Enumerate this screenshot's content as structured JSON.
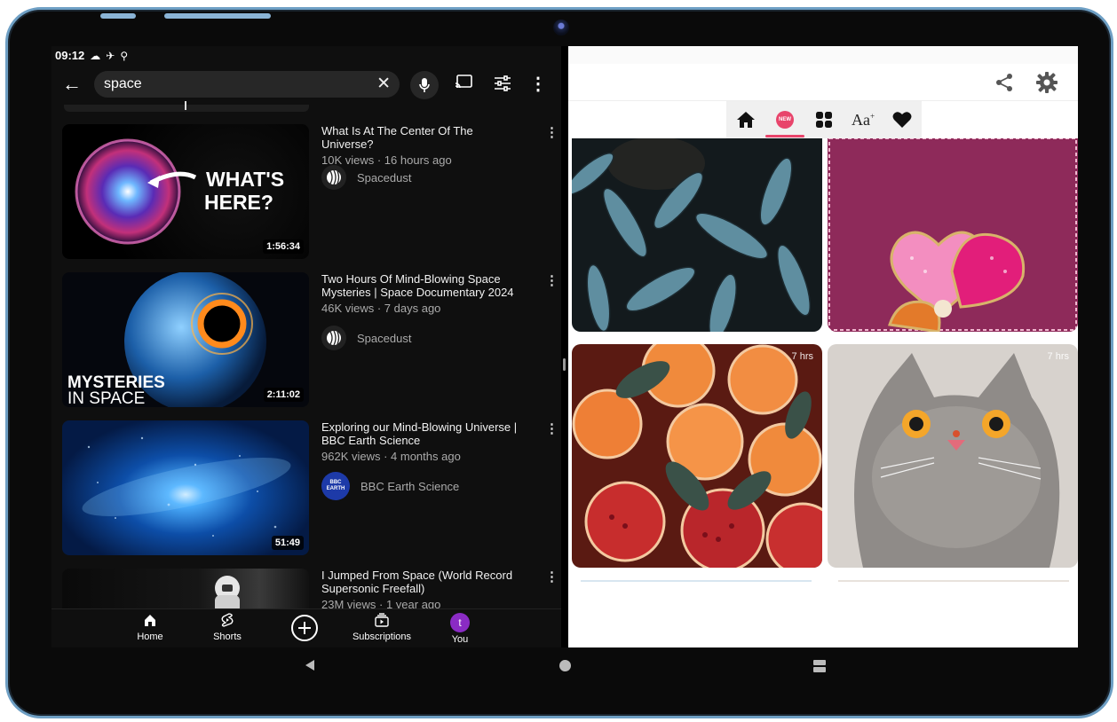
{
  "status": {
    "time": "09:12"
  },
  "search": {
    "query": "space"
  },
  "videos": [
    {
      "title": "What Is At The Center Of The Universe?",
      "meta": "10K views · 16 hours ago",
      "channel": "Spacedust",
      "duration": "1:56:34",
      "overlay": [
        "WHAT'S",
        "HERE?"
      ]
    },
    {
      "title": "Two Hours Of Mind-Blowing Space Mysteries | Space Documentary 2024",
      "meta": "46K views · 7 days ago",
      "channel": "Spacedust",
      "duration": "2:11:02",
      "overlay": [
        "MYSTERIES",
        "IN SPACE"
      ]
    },
    {
      "title": "Exploring our Mind-Blowing Universe | BBC Earth Science",
      "meta": "962K views · 4 months ago",
      "channel": "BBC Earth Science",
      "duration": "51:49",
      "channel_badge": [
        "BBC",
        "EARTH"
      ]
    },
    {
      "title": "I Jumped From Space (World Record Supersonic Freefall)",
      "meta": "23M views · 1 year ago"
    }
  ],
  "nav": {
    "home": "Home",
    "shorts": "Shorts",
    "subscriptions": "Subscriptions",
    "you": "You",
    "avatar": "t"
  },
  "wallpaper": {
    "new_badge": "NEW",
    "font_tab": "Aa",
    "tiles": [
      {
        "tag": ""
      },
      {
        "tag": ""
      },
      {
        "tag": "7 hrs"
      },
      {
        "tag": "7 hrs"
      }
    ]
  },
  "colors": {
    "accent": "#e8446b",
    "yt_bg": "#0f0f0f",
    "frame": "#6e9fc4"
  }
}
